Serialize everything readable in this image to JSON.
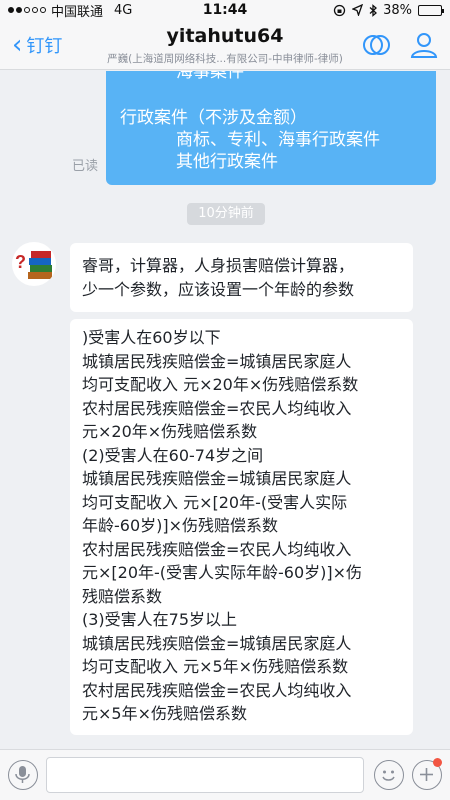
{
  "status_bar": {
    "carrier": "中国联通",
    "network": "4G",
    "time": "11:44",
    "battery": "38%",
    "battery_level": 0.38
  },
  "nav": {
    "back_label": "钉钉",
    "title": "yitahutu64",
    "subtitle": "严巍(上海道周网络科技...有限公司-中申律师-律师)"
  },
  "chat": {
    "outgoing_message": {
      "lines": [
        "海事案件",
        "",
        "行政案件（不涉及金额）",
        "商标、专利、海事行政案件",
        "其他行政案件"
      ],
      "status": "已读"
    },
    "time_divider": "10分钟前",
    "incoming_messages": [
      {
        "lines": [
          "睿哥，计算器，人身损害赔偿计算器，",
          "少一个参数，应该设置一个年龄的参数"
        ]
      },
      {
        "lines": [
          ")受害人在60岁以下",
          "城镇居民残疾赔偿金=城镇居民家庭人",
          "均可支配收入 元×20年×伤残赔偿系数",
          "农村居民残疾赔偿金=农民人均纯收入",
          "元×20年×伤残赔偿系数",
          "(2)受害人在60-74岁之间",
          "城镇居民残疾赔偿金=城镇居民家庭人",
          "均可支配收入 元×[20年-(受害人实际",
          "年龄-60岁)]×伤残赔偿系数",
          "农村居民残疾赔偿金=农民人均纯收入",
          "元×[20年-(受害人实际年龄-60岁)]×伤",
          "残赔偿系数",
          "(3)受害人在75岁以上",
          "城镇居民残疾赔偿金=城镇居民家庭人",
          "均可支配收入 元×5年×伤残赔偿系数",
          "农村居民残疾赔偿金=农民人均纯收入",
          "元×5年×伤残赔偿系数"
        ]
      }
    ]
  },
  "colors": {
    "accent": "#3296fa",
    "outgoing_bubble": "#58b3f5",
    "badge": "#f25643"
  },
  "icons": {
    "back": "chevron-left-icon",
    "call": "call-icon",
    "profile": "profile-icon",
    "voice": "microphone-icon",
    "emoji": "emoji-icon",
    "plus": "plus-icon"
  }
}
